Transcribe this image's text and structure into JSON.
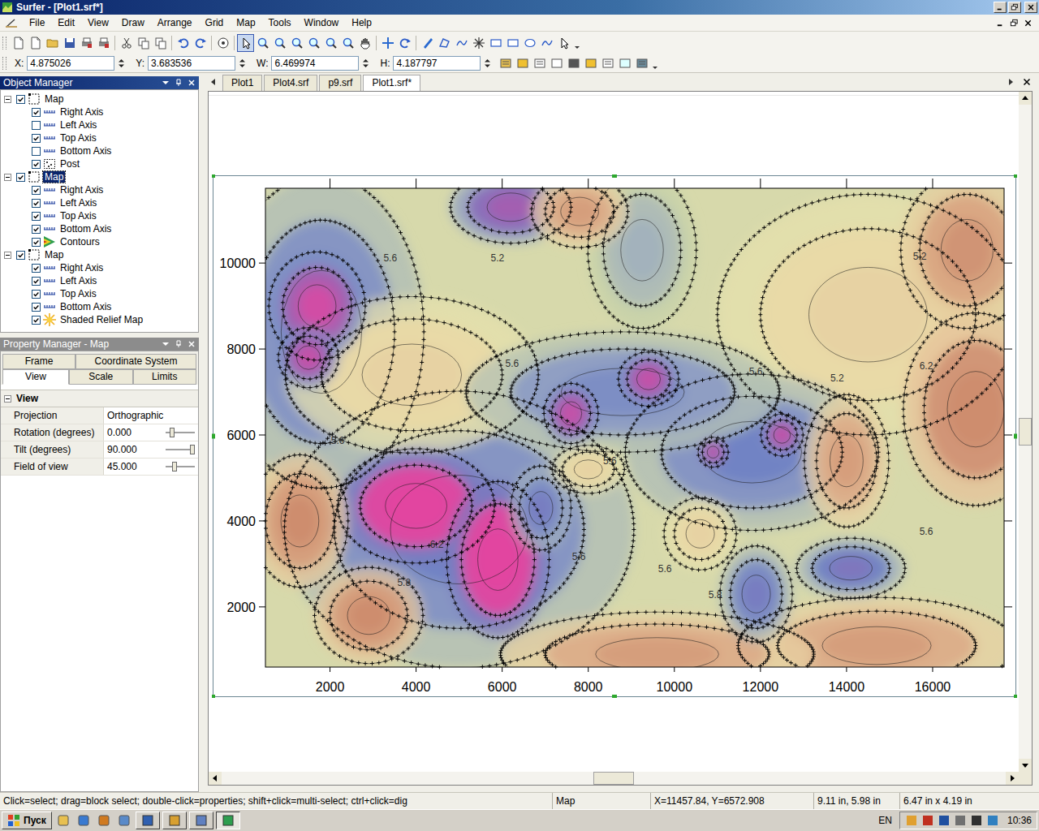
{
  "window": {
    "title": "Surfer - [Plot1.srf*]"
  },
  "menu": [
    "File",
    "Edit",
    "View",
    "Draw",
    "Arrange",
    "Grid",
    "Map",
    "Tools",
    "Window",
    "Help"
  ],
  "coords": [
    {
      "label": "X:",
      "value": "4.875026"
    },
    {
      "label": "Y:",
      "value": "3.683536"
    },
    {
      "label": "W:",
      "value": "6.469974"
    },
    {
      "label": "H:",
      "value": "4.187797"
    }
  ],
  "object_manager": {
    "title": "Object Manager",
    "groups": [
      {
        "label": "Map",
        "checked": true,
        "expanded": true,
        "selected": false,
        "children": [
          {
            "label": "Right Axis",
            "kind": "axis",
            "checked": true,
            "selected": false
          },
          {
            "label": "Left Axis",
            "kind": "axis",
            "checked": false,
            "selected": false
          },
          {
            "label": "Top Axis",
            "kind": "axis",
            "checked": true,
            "selected": false
          },
          {
            "label": "Bottom Axis",
            "kind": "axis",
            "checked": false,
            "selected": false
          },
          {
            "label": "Post",
            "kind": "post",
            "checked": true,
            "selected": false
          }
        ]
      },
      {
        "label": "Map",
        "checked": true,
        "expanded": true,
        "selected": true,
        "children": [
          {
            "label": "Right Axis",
            "kind": "axis",
            "checked": true,
            "selected": false
          },
          {
            "label": "Left Axis",
            "kind": "axis",
            "checked": true,
            "selected": false
          },
          {
            "label": "Top Axis",
            "kind": "axis",
            "checked": true,
            "selected": false
          },
          {
            "label": "Bottom Axis",
            "kind": "axis",
            "checked": true,
            "selected": false
          },
          {
            "label": "Contours",
            "kind": "contours",
            "checked": true,
            "selected": false
          }
        ]
      },
      {
        "label": "Map",
        "checked": true,
        "expanded": true,
        "selected": false,
        "children": [
          {
            "label": "Right Axis",
            "kind": "axis",
            "checked": true,
            "selected": false
          },
          {
            "label": "Left Axis",
            "kind": "axis",
            "checked": true,
            "selected": false
          },
          {
            "label": "Top Axis",
            "kind": "axis",
            "checked": true,
            "selected": false
          },
          {
            "label": "Bottom Axis",
            "kind": "axis",
            "checked": true,
            "selected": false
          },
          {
            "label": "Shaded Relief Map",
            "kind": "relief",
            "checked": true,
            "selected": false
          }
        ]
      }
    ]
  },
  "property_manager": {
    "title": "Property Manager - Map",
    "tab_rows": [
      [
        {
          "label": "Frame",
          "selected": false
        },
        {
          "label": "Coordinate System",
          "selected": false
        }
      ],
      [
        {
          "label": "View",
          "selected": true
        },
        {
          "label": "Scale",
          "selected": false
        },
        {
          "label": "Limits",
          "selected": false
        }
      ]
    ],
    "section": {
      "label": "View",
      "expanded": true
    },
    "properties": [
      {
        "name": "Projection",
        "value": "Orthographic",
        "kind": "text"
      },
      {
        "name": "Rotation (degrees)",
        "value": "0.000",
        "kind": "slider",
        "level": 0.15
      },
      {
        "name": "Tilt (degrees)",
        "value": "90.000",
        "kind": "slider",
        "level": 1
      },
      {
        "name": "Field of view",
        "value": "45.000",
        "kind": "slider",
        "level": 0.25
      }
    ]
  },
  "documents": [
    {
      "label": "Plot1",
      "selected": false
    },
    {
      "label": "Plot4.srf",
      "selected": false
    },
    {
      "label": "p9.srf",
      "selected": false
    },
    {
      "label": "Plot1.srf*",
      "selected": true
    }
  ],
  "scroll": {
    "vertical": 0.5,
    "horizontal": 0.5
  },
  "map": {
    "extent": {
      "x_min": 500,
      "x_max": 17660,
      "y_min": 600,
      "y_max": 11740
    },
    "base_value": 5.6,
    "x_ticks": [
      "2000",
      "4000",
      "6000",
      "8000",
      "10000",
      "12000",
      "14000",
      "16000"
    ],
    "y_ticks": [
      "2000",
      "4000",
      "6000",
      "8000",
      "10000"
    ],
    "anomalies": [
      {
        "x": 5000,
        "y": 3800,
        "rx": 2900,
        "ry": 2300,
        "value": 6.0
      },
      {
        "x": 1800,
        "y": 8400,
        "rx": 1700,
        "ry": 2600,
        "value": 6.0
      },
      {
        "x": 8800,
        "y": 7000,
        "rx": 2600,
        "ry": 1000,
        "value": 5.95
      },
      {
        "x": 11800,
        "y": 5600,
        "rx": 2100,
        "ry": 1300,
        "value": 6.0
      },
      {
        "x": 3900,
        "y": 7400,
        "rx": 2100,
        "ry": 1300,
        "value": 5.45
      },
      {
        "x": 14500,
        "y": 8800,
        "rx": 2500,
        "ry": 2000,
        "value": 5.45
      },
      {
        "x": 17000,
        "y": 6600,
        "rx": 1200,
        "ry": 1600,
        "value": 5.05
      },
      {
        "x": 16800,
        "y": 10300,
        "rx": 1100,
        "ry": 1300,
        "value": 5.15
      },
      {
        "x": 6200,
        "y": 11300,
        "rx": 1000,
        "ry": 600,
        "value": 6.3
      },
      {
        "x": 7800,
        "y": 11200,
        "rx": 800,
        "ry": 600,
        "value": 5.2
      },
      {
        "x": 9250,
        "y": 10300,
        "rx": 900,
        "ry": 1300,
        "value": 5.8
      },
      {
        "x": 1300,
        "y": 4000,
        "rx": 800,
        "ry": 1100,
        "value": 5.1
      },
      {
        "x": 2900,
        "y": 1800,
        "rx": 900,
        "ry": 800,
        "value": 5.1
      },
      {
        "x": 9600,
        "y": 900,
        "rx": 2600,
        "ry": 700,
        "value": 5.2
      },
      {
        "x": 14700,
        "y": 1100,
        "rx": 2300,
        "ry": 800,
        "value": 5.2
      },
      {
        "x": 14000,
        "y": 5400,
        "rx": 700,
        "ry": 1100,
        "value": 5.2
      },
      {
        "x": 4000,
        "y": 4350,
        "rx": 1300,
        "ry": 950,
        "value": 6.8
      },
      {
        "x": 5900,
        "y": 3100,
        "rx": 850,
        "ry": 1300,
        "value": 6.8
      },
      {
        "x": 1700,
        "y": 9000,
        "rx": 800,
        "ry": 900,
        "value": 6.5
      },
      {
        "x": 1500,
        "y": 7800,
        "rx": 500,
        "ry": 500,
        "value": 6.45
      },
      {
        "x": 9400,
        "y": 7300,
        "rx": 500,
        "ry": 450,
        "value": 6.45
      },
      {
        "x": 7600,
        "y": 6500,
        "rx": 450,
        "ry": 500,
        "value": 6.45
      },
      {
        "x": 12500,
        "y": 6000,
        "rx": 350,
        "ry": 350,
        "value": 6.45
      },
      {
        "x": 10900,
        "y": 5600,
        "rx": 250,
        "ry": 250,
        "value": 6.45
      },
      {
        "x": 11900,
        "y": 2300,
        "rx": 600,
        "ry": 800,
        "value": 6.05
      },
      {
        "x": 14100,
        "y": 2900,
        "rx": 900,
        "ry": 500,
        "value": 6.1
      },
      {
        "x": 6900,
        "y": 4300,
        "rx": 500,
        "ry": 700,
        "value": 6.05
      },
      {
        "x": 8000,
        "y": 5200,
        "rx": 600,
        "ry": 400,
        "value": 5.45
      },
      {
        "x": 10600,
        "y": 3700,
        "rx": 600,
        "ry": 600,
        "value": 5.45
      }
    ],
    "contour_labels": [
      {
        "text": "5.6",
        "x": 3400,
        "y": 10040
      },
      {
        "text": "5.2",
        "x": 5890,
        "y": 10040
      },
      {
        "text": "5.2",
        "x": 15700,
        "y": 10080
      },
      {
        "text": "6.2",
        "x": 15850,
        "y": 7530
      },
      {
        "text": "5.6",
        "x": 6230,
        "y": 7590
      },
      {
        "text": "5.6",
        "x": 11890,
        "y": 7400
      },
      {
        "text": "5.2",
        "x": 13780,
        "y": 7250
      },
      {
        "text": "5.6",
        "x": 2180,
        "y": 5790
      },
      {
        "text": "5.6",
        "x": 8500,
        "y": 5320
      },
      {
        "text": "6.2",
        "x": 4480,
        "y": 3380
      },
      {
        "text": "5.8",
        "x": 3720,
        "y": 2490
      },
      {
        "text": "5.6",
        "x": 7780,
        "y": 3090
      },
      {
        "text": "5.6",
        "x": 9780,
        "y": 2810
      },
      {
        "text": "5.8",
        "x": 10950,
        "y": 2200
      },
      {
        "text": "5.6",
        "x": 15850,
        "y": 3680
      }
    ]
  },
  "status_bar": {
    "message": "Click=select; drag=block select; double-click=properties; shift+click=multi-select; ctrl+click=dig",
    "object": "Map",
    "cursor": "X=11457.84, Y=6572.908",
    "position": "9.11 in, 5.98 in",
    "size": "6.47 in x 4.19 in"
  },
  "taskbar": {
    "start": "Пуск",
    "language": "EN",
    "clock": "10:36"
  }
}
